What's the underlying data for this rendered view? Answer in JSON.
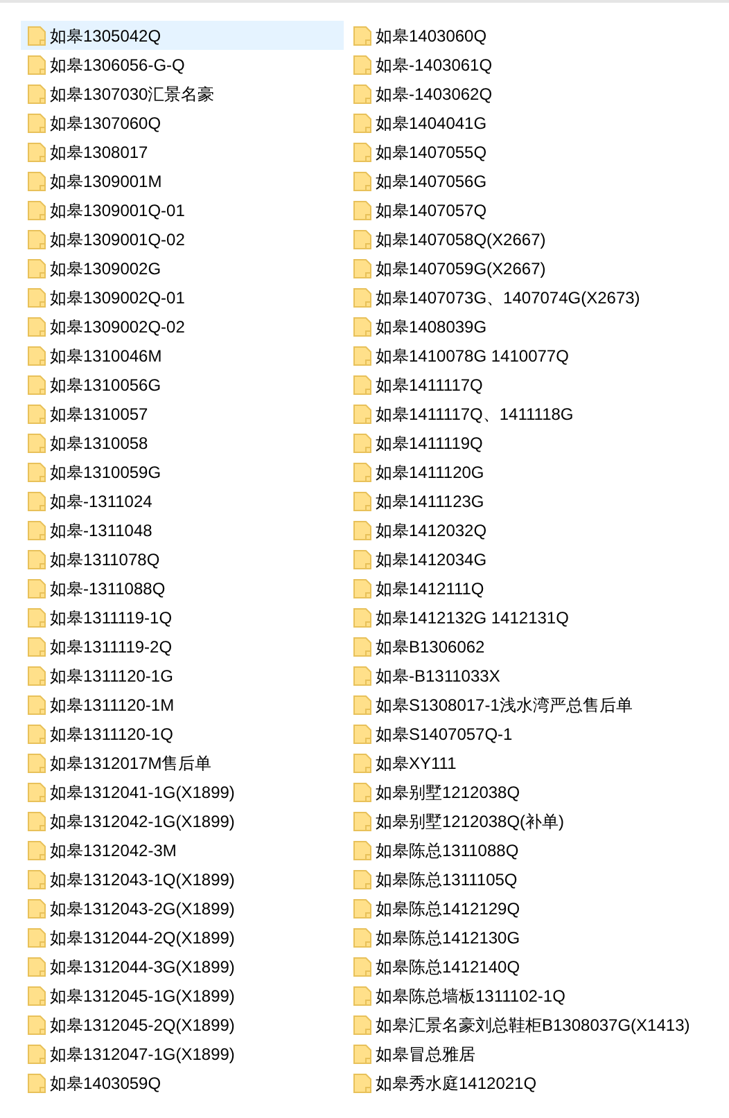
{
  "columns": [
    {
      "items": [
        {
          "name": "如皋1305042Q",
          "selected": true
        },
        {
          "name": "如皋1306056-G-Q",
          "selected": false
        },
        {
          "name": "如皋1307030汇景名豪",
          "selected": false
        },
        {
          "name": "如皋1307060Q",
          "selected": false
        },
        {
          "name": "如皋1308017",
          "selected": false
        },
        {
          "name": "如皋1309001M",
          "selected": false
        },
        {
          "name": "如皋1309001Q-01",
          "selected": false
        },
        {
          "name": "如皋1309001Q-02",
          "selected": false
        },
        {
          "name": "如皋1309002G",
          "selected": false
        },
        {
          "name": "如皋1309002Q-01",
          "selected": false
        },
        {
          "name": "如皋1309002Q-02",
          "selected": false
        },
        {
          "name": "如皋1310046M",
          "selected": false
        },
        {
          "name": "如皋1310056G",
          "selected": false
        },
        {
          "name": "如皋1310057",
          "selected": false
        },
        {
          "name": "如皋1310058",
          "selected": false
        },
        {
          "name": "如皋1310059G",
          "selected": false
        },
        {
          "name": "如皋-1311024",
          "selected": false
        },
        {
          "name": "如皋-1311048",
          "selected": false
        },
        {
          "name": "如皋1311078Q",
          "selected": false
        },
        {
          "name": "如皋-1311088Q",
          "selected": false
        },
        {
          "name": "如皋1311119-1Q",
          "selected": false
        },
        {
          "name": "如皋1311119-2Q",
          "selected": false
        },
        {
          "name": "如皋1311120-1G",
          "selected": false
        },
        {
          "name": "如皋1311120-1M",
          "selected": false
        },
        {
          "name": "如皋1311120-1Q",
          "selected": false
        },
        {
          "name": "如皋1312017M售后单",
          "selected": false
        },
        {
          "name": "如皋1312041-1G(X1899)",
          "selected": false
        },
        {
          "name": "如皋1312042-1G(X1899)",
          "selected": false
        },
        {
          "name": "如皋1312042-3M",
          "selected": false
        },
        {
          "name": "如皋1312043-1Q(X1899)",
          "selected": false
        },
        {
          "name": "如皋1312043-2G(X1899)",
          "selected": false
        },
        {
          "name": "如皋1312044-2Q(X1899)",
          "selected": false
        },
        {
          "name": "如皋1312044-3G(X1899)",
          "selected": false
        },
        {
          "name": "如皋1312045-1G(X1899)",
          "selected": false
        },
        {
          "name": "如皋1312045-2Q(X1899)",
          "selected": false
        },
        {
          "name": "如皋1312047-1G(X1899)",
          "selected": false
        },
        {
          "name": "如皋1403059Q",
          "selected": false
        }
      ]
    },
    {
      "items": [
        {
          "name": "如皋1403060Q",
          "selected": false
        },
        {
          "name": "如皋-1403061Q",
          "selected": false
        },
        {
          "name": "如皋-1403062Q",
          "selected": false
        },
        {
          "name": "如皋1404041G",
          "selected": false
        },
        {
          "name": "如皋1407055Q",
          "selected": false
        },
        {
          "name": "如皋1407056G",
          "selected": false
        },
        {
          "name": "如皋1407057Q",
          "selected": false
        },
        {
          "name": "如皋1407058Q(X2667)",
          "selected": false
        },
        {
          "name": "如皋1407059G(X2667)",
          "selected": false
        },
        {
          "name": "如皋1407073G、1407074G(X2673)",
          "selected": false
        },
        {
          "name": "如皋1408039G",
          "selected": false
        },
        {
          "name": "如皋1410078G 1410077Q",
          "selected": false
        },
        {
          "name": "如皋1411117Q",
          "selected": false
        },
        {
          "name": "如皋1411117Q、1411118G",
          "selected": false
        },
        {
          "name": "如皋1411119Q",
          "selected": false
        },
        {
          "name": "如皋1411120G",
          "selected": false
        },
        {
          "name": "如皋1411123G",
          "selected": false
        },
        {
          "name": "如皋1412032Q",
          "selected": false
        },
        {
          "name": "如皋1412034G",
          "selected": false
        },
        {
          "name": "如皋1412111Q",
          "selected": false
        },
        {
          "name": "如皋1412132G 1412131Q",
          "selected": false
        },
        {
          "name": "如皋B1306062",
          "selected": false
        },
        {
          "name": "如皋-B1311033X",
          "selected": false
        },
        {
          "name": "如皋S1308017-1浅水湾严总售后单",
          "selected": false
        },
        {
          "name": "如皋S1407057Q-1",
          "selected": false
        },
        {
          "name": "如皋XY111",
          "selected": false
        },
        {
          "name": "如皋别墅1212038Q",
          "selected": false
        },
        {
          "name": "如皋别墅1212038Q(补单)",
          "selected": false
        },
        {
          "name": "如皋陈总1311088Q",
          "selected": false
        },
        {
          "name": "如皋陈总1311105Q",
          "selected": false
        },
        {
          "name": "如皋陈总1412129Q",
          "selected": false
        },
        {
          "name": "如皋陈总1412130G",
          "selected": false
        },
        {
          "name": "如皋陈总1412140Q",
          "selected": false
        },
        {
          "name": "如皋陈总墙板1311102-1Q",
          "selected": false
        },
        {
          "name": "如皋汇景名豪刘总鞋柜B1308037G(X1413)",
          "selected": false
        },
        {
          "name": "如皋冒总雅居",
          "selected": false
        },
        {
          "name": "如皋秀水庭1412021Q",
          "selected": false
        }
      ]
    }
  ]
}
